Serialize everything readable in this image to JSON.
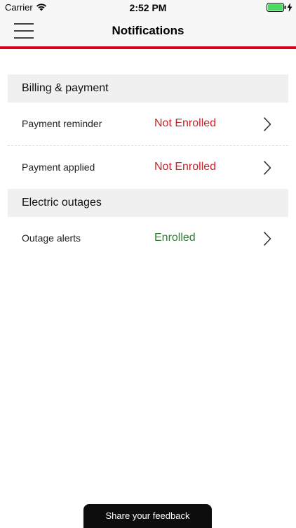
{
  "status_bar": {
    "carrier": "Carrier",
    "time": "2:52 PM",
    "icons": [
      "wifi-icon",
      "battery-icon",
      "charge-icon"
    ],
    "battery_color": "#4cd964"
  },
  "nav": {
    "title": "Notifications",
    "menu_icon": "menu-icon",
    "accent_color": "#d6001c"
  },
  "sections": [
    {
      "title": "Billing & payment",
      "items": [
        {
          "label": "Payment reminder",
          "status": "Not Enrolled",
          "status_color": "#c8232c"
        },
        {
          "label": "Payment applied",
          "status": "Not Enrolled",
          "status_color": "#c8232c"
        }
      ]
    },
    {
      "title": "Electric outages",
      "items": [
        {
          "label": "Outage alerts",
          "status": "Enrolled",
          "status_color": "#2e7d32"
        }
      ]
    }
  ],
  "footer": {
    "feedback_label": "Share your feedback"
  }
}
